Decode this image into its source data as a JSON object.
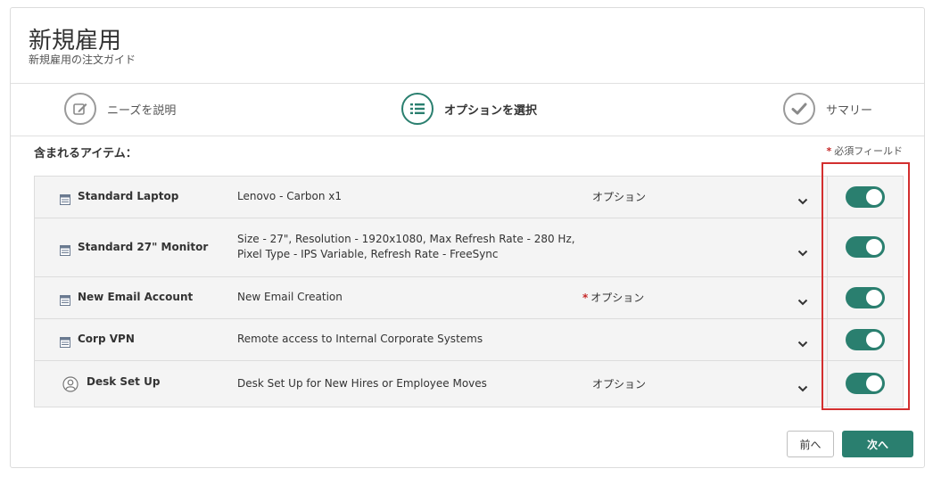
{
  "header": {
    "title": "新規雇用",
    "subtitle": "新規雇用の注文ガイド"
  },
  "steps": [
    {
      "label": "ニーズを説明",
      "icon": "edit-icon",
      "state": "inactive"
    },
    {
      "label": "オプションを選択",
      "icon": "list-icon",
      "state": "active"
    },
    {
      "label": "サマリー",
      "icon": "check-icon",
      "state": "inactive"
    }
  ],
  "items_section": {
    "heading": "含まれるアイテム：",
    "required_star": "*",
    "required_note": "必須フィールド"
  },
  "items": [
    {
      "name": "Standard Laptop",
      "description": "Lenovo - Carbon x1",
      "option_label": "オプション",
      "required": false,
      "icon": "catalog-icon",
      "enabled": true
    },
    {
      "name": "Standard 27\" Monitor",
      "description": "Size - 27\", Resolution - 1920x1080, Max Refresh Rate - 280 Hz, Pixel Type - IPS Variable, Refresh Rate - FreeSync",
      "option_label": "",
      "required": false,
      "icon": "catalog-icon",
      "enabled": true
    },
    {
      "name": "New Email Account",
      "description": "New Email Creation",
      "option_label": "オプション",
      "required": true,
      "icon": "catalog-icon",
      "enabled": true
    },
    {
      "name": "Corp VPN",
      "description": "Remote access to Internal Corporate Systems",
      "option_label": "",
      "required": false,
      "icon": "catalog-icon",
      "enabled": true
    },
    {
      "name": "Desk Set Up",
      "description": "Desk Set Up for New Hires or Employee Moves",
      "option_label": "オプション",
      "required": false,
      "icon": "user-icon",
      "enabled": true
    }
  ],
  "buttons": {
    "prev_label": "前へ",
    "next_label": "次へ"
  },
  "colors": {
    "accent": "#2a7f6f",
    "required": "#c62828",
    "highlight": "#d32f2f"
  }
}
